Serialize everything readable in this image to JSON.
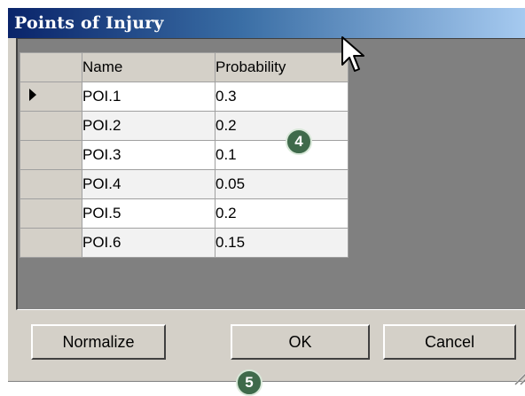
{
  "window": {
    "title": "Points of Injury"
  },
  "grid": {
    "columns": [
      "Name",
      "Probability"
    ],
    "rows": [
      {
        "name": "POI.1",
        "probability": "0.3",
        "current": true
      },
      {
        "name": "POI.2",
        "probability": "0.2",
        "current": false
      },
      {
        "name": "POI.3",
        "probability": "0.1",
        "current": false
      },
      {
        "name": "POI.4",
        "probability": "0.05",
        "current": false
      },
      {
        "name": "POI.5",
        "probability": "0.2",
        "current": false
      },
      {
        "name": "POI.6",
        "probability": "0.15",
        "current": false
      }
    ]
  },
  "buttons": {
    "normalize": "Normalize",
    "ok": "OK",
    "cancel": "Cancel"
  },
  "annotations": {
    "callout_4": "4",
    "callout_5": "5"
  },
  "icons": {
    "row_indicator": "right-triangle-icon",
    "cursor": "mouse-pointer-icon",
    "size_grip": "resize-grip-icon"
  },
  "colors": {
    "title_start": "#0a246a",
    "title_end": "#a6caf0",
    "dialog_bg": "#d4d0c8",
    "grid_bg": "#808080",
    "badge": "#3f6a4b"
  }
}
